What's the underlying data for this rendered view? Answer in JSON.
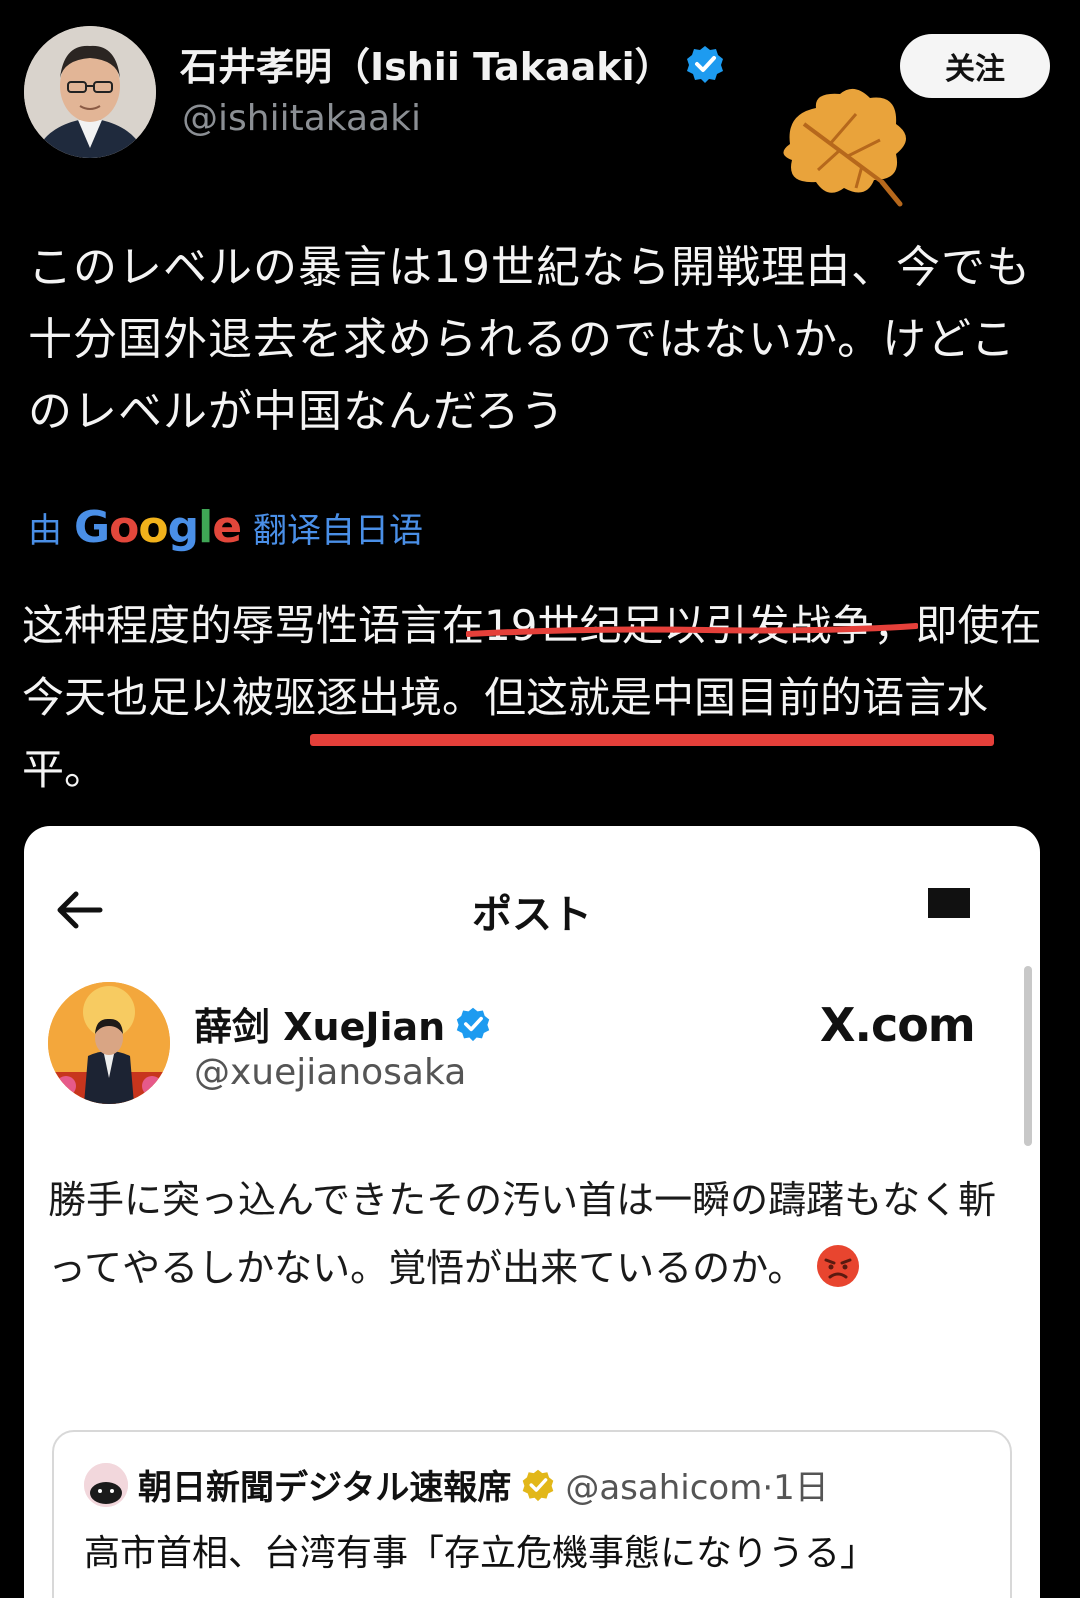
{
  "outer_post": {
    "author_name": "石井孝明（Ishii Takaaki）",
    "handle": "@ishiitakaaki",
    "follow_label": "关注",
    "text_jp": "このレベルの暴言は19世紀なら開戦理由、今でも十分国外退去を求められるのではないか。けどこのレベルが中国なんだろう",
    "translate_prefix": "由",
    "translate_brand": "Google",
    "translate_suffix": "翻译自日语",
    "translated_cn_before": "这种程度的辱骂性语言",
    "translated_cn_highlight": "在19世纪足以引发战争",
    "translated_cn_after": "，即使在今天也足以被驱逐出境。但这就是中国目前的语言水平。"
  },
  "embedded_screenshot": {
    "header_title": "ポスト",
    "author_name": "薛剑 XueJian",
    "handle": "@xuejianosaka",
    "site_label": "X.com",
    "post_text": "勝手に突っ込んできたその汚い首は一瞬の躊躇もなく斬ってやるしかない。覚悟が出来ているのか。",
    "quoted": {
      "author_name": "朝日新聞デジタル速報席",
      "handle_meta": "@asahicom·1日",
      "text": "高市首相、台湾有事「存立危機事態になりうる」"
    }
  },
  "icons": {
    "verified_outer": "verified-badge-icon",
    "leaf": "maple-leaf-icon",
    "back": "back-arrow-icon",
    "menu": "menu-icon",
    "angry": "angry-face-icon",
    "verified_gold": "gold-verified-badge-icon"
  },
  "colors": {
    "highlight_underline": "#e5403a",
    "translate_blue": "#4a8fe7",
    "verified_blue": "#1d9bf0",
    "verified_gold": "#e2b719"
  }
}
